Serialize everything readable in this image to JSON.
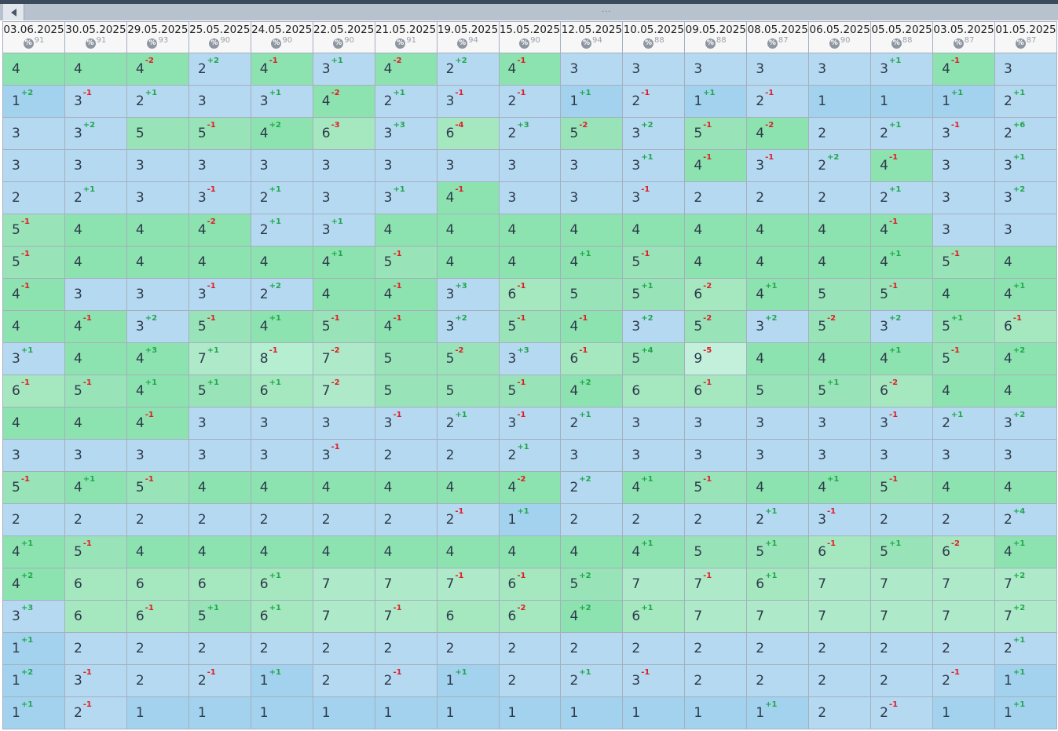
{
  "ui": {
    "scroll_grip": "...",
    "percent_icon": "%"
  },
  "columns": [
    {
      "date": "03.06.2025",
      "pct": "91"
    },
    {
      "date": "30.05.2025",
      "pct": "91"
    },
    {
      "date": "29.05.2025",
      "pct": "93"
    },
    {
      "date": "25.05.2025",
      "pct": "90"
    },
    {
      "date": "24.05.2025",
      "pct": "90"
    },
    {
      "date": "22.05.2025",
      "pct": "90"
    },
    {
      "date": "21.05.2025",
      "pct": "91"
    },
    {
      "date": "19.05.2025",
      "pct": "94"
    },
    {
      "date": "15.05.2025",
      "pct": "90"
    },
    {
      "date": "12.05.2025",
      "pct": "94"
    },
    {
      "date": "10.05.2025",
      "pct": "88"
    },
    {
      "date": "09.05.2025",
      "pct": "88"
    },
    {
      "date": "08.05.2025",
      "pct": "87"
    },
    {
      "date": "06.05.2025",
      "pct": "90"
    },
    {
      "date": "05.05.2025",
      "pct": "88"
    },
    {
      "date": "03.05.2025",
      "pct": "87"
    },
    {
      "date": "01.05.2025",
      "pct": "87"
    }
  ],
  "rows": [
    [
      "4",
      "4",
      "4 -2",
      "2 +2",
      "4 -1",
      "3 +1",
      "4 -2",
      "2 +2",
      "4 -1",
      "3",
      "3",
      "3",
      "3",
      "3",
      "3 +1",
      "4 -1",
      "3"
    ],
    [
      "1 +2",
      "3 -1",
      "2 +1",
      "3",
      "3 +1",
      "4 -2",
      "2 +1",
      "3 -1",
      "2 -1",
      "1 +1",
      "2 -1",
      "1 +1",
      "2 -1",
      "1",
      "1",
      "1 +1",
      "2 +1"
    ],
    [
      "3",
      "3 +2",
      "5",
      "5 -1",
      "4 +2",
      "6 -3",
      "3 +3",
      "6 -4",
      "2 +3",
      "5 -2",
      "3 +2",
      "5 -1",
      "4 -2",
      "2",
      "2 +1",
      "3 -1",
      "2 +6"
    ],
    [
      "3",
      "3",
      "3",
      "3",
      "3",
      "3",
      "3",
      "3",
      "3",
      "3",
      "3 +1",
      "4 -1",
      "3 -1",
      "2 +2",
      "4 -1",
      "3",
      "3 +1"
    ],
    [
      "2",
      "2 +1",
      "3",
      "3 -1",
      "2 +1",
      "3",
      "3 +1",
      "4 -1",
      "3",
      "3",
      "3 -1",
      "2",
      "2",
      "2",
      "2 +1",
      "3",
      "3 +2"
    ],
    [
      "5 -1",
      "4",
      "4",
      "4 -2",
      "2 +1",
      "3 +1",
      "4",
      "4",
      "4",
      "4",
      "4",
      "4",
      "4",
      "4",
      "4 -1",
      "3",
      "3"
    ],
    [
      "5 -1",
      "4",
      "4",
      "4",
      "4",
      "4 +1",
      "5 -1",
      "4",
      "4",
      "4 +1",
      "5 -1",
      "4",
      "4",
      "4",
      "4 +1",
      "5 -1",
      "4"
    ],
    [
      "4 -1",
      "3",
      "3",
      "3 -1",
      "2 +2",
      "4",
      "4 -1",
      "3 +3",
      "6 -1",
      "5",
      "5 +1",
      "6 -2",
      "4 +1",
      "5",
      "5 -1",
      "4",
      "4 +1"
    ],
    [
      "4",
      "4 -1",
      "3 +2",
      "5 -1",
      "4 +1",
      "5 -1",
      "4 -1",
      "3 +2",
      "5 -1",
      "4 -1",
      "3 +2",
      "5 -2",
      "3 +2",
      "5 -2",
      "3 +2",
      "5 +1",
      "6 -1"
    ],
    [
      "3 +1",
      "4",
      "4 +3",
      "7 +1",
      "8 -1",
      "7 -2",
      "5",
      "5 -2",
      "3 +3",
      "6 -1",
      "5 +4",
      "9 -5",
      "4",
      "4",
      "4 +1",
      "5 -1",
      "4 +2"
    ],
    [
      "6 -1",
      "5 -1",
      "4 +1",
      "5 +1",
      "6 +1",
      "7 -2",
      "5",
      "5",
      "5 -1",
      "4 +2",
      "6",
      "6 -1",
      "5",
      "5 +1",
      "6 -2",
      "4",
      "4"
    ],
    [
      "4",
      "4",
      "4 -1",
      "3",
      "3",
      "3",
      "3 -1",
      "2 +1",
      "3 -1",
      "2 +1",
      "3",
      "3",
      "3",
      "3",
      "3 -1",
      "2 +1",
      "3 +2"
    ],
    [
      "3",
      "3",
      "3",
      "3",
      "3",
      "3 -1",
      "2",
      "2",
      "2 +1",
      "3",
      "3",
      "3",
      "3",
      "3",
      "3",
      "3",
      "3"
    ],
    [
      "5 -1",
      "4 +1",
      "5 -1",
      "4",
      "4",
      "4",
      "4",
      "4",
      "4 -2",
      "2 +2",
      "4 +1",
      "5 -1",
      "4",
      "4 +1",
      "5 -1",
      "4",
      "4"
    ],
    [
      "2",
      "2",
      "2",
      "2",
      "2",
      "2",
      "2",
      "2 -1",
      "1 +1",
      "2",
      "2",
      "2",
      "2 +1",
      "3 -1",
      "2",
      "2",
      "2 +4"
    ],
    [
      "4 +1",
      "5 -1",
      "4",
      "4",
      "4",
      "4",
      "4",
      "4",
      "4",
      "4",
      "4 +1",
      "5",
      "5 +1",
      "6 -1",
      "5 +1",
      "6 -2",
      "4 +1"
    ],
    [
      "4 +2",
      "6",
      "6",
      "6",
      "6 +1",
      "7",
      "7",
      "7 -1",
      "6 -1",
      "5 +2",
      "7",
      "7 -1",
      "6 +1",
      "7",
      "7",
      "7",
      "7 +2"
    ],
    [
      "3 +3",
      "6",
      "6 -1",
      "5 +1",
      "6 +1",
      "7",
      "7 -1",
      "6",
      "6 -2",
      "4 +2",
      "6 +1",
      "7",
      "7",
      "7",
      "7",
      "7",
      "7 +2"
    ],
    [
      "1 +1",
      "2",
      "2",
      "2",
      "2",
      "2",
      "2",
      "2",
      "2",
      "2",
      "2",
      "2",
      "2",
      "2",
      "2",
      "2",
      "2 +1"
    ],
    [
      "1 +2",
      "3 -1",
      "2",
      "2 -1",
      "1 +1",
      "2",
      "2 -1",
      "1 +1",
      "2",
      "2 +1",
      "3 -1",
      "2",
      "2",
      "2",
      "2",
      "2 -1",
      "1 +1"
    ],
    [
      "1 +1",
      "2 -1",
      "1",
      "1",
      "1",
      "1",
      "1",
      "1",
      "1",
      "1",
      "1",
      "1",
      "1 +1",
      "2",
      "2 -1",
      "1",
      "1 +1"
    ]
  ]
}
